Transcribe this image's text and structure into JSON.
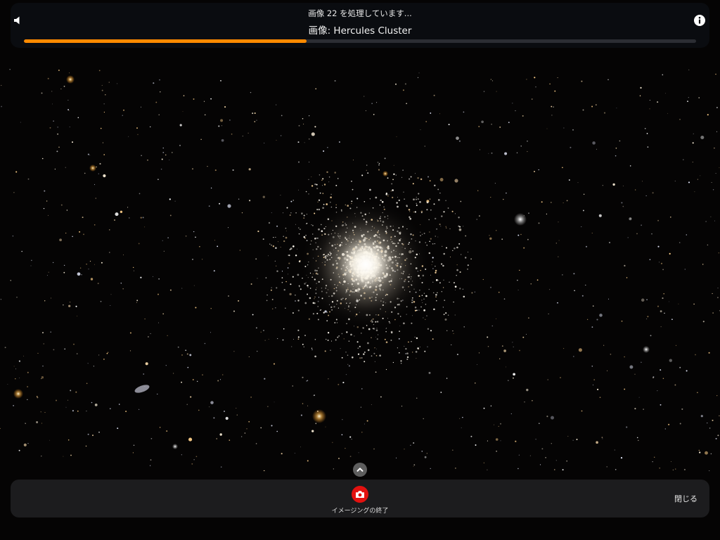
{
  "header": {
    "processing_status": "画像 22 を処理しています...",
    "image_name": "画像: Hercules Cluster",
    "progress_fraction": 0.42,
    "progress_color": "#ff8a00",
    "speaker_icon": "speaker-icon",
    "info_icon": "info-icon"
  },
  "viewer": {
    "subject": "Hercules Cluster",
    "background_color": "#050404"
  },
  "controls": {
    "expand_icon": "chevron-up-icon",
    "stop_imaging_label": "イメージングの終了",
    "stop_imaging_icon": "camera-icon",
    "stop_imaging_color": "#e3110f",
    "close_label": "閉じる"
  }
}
